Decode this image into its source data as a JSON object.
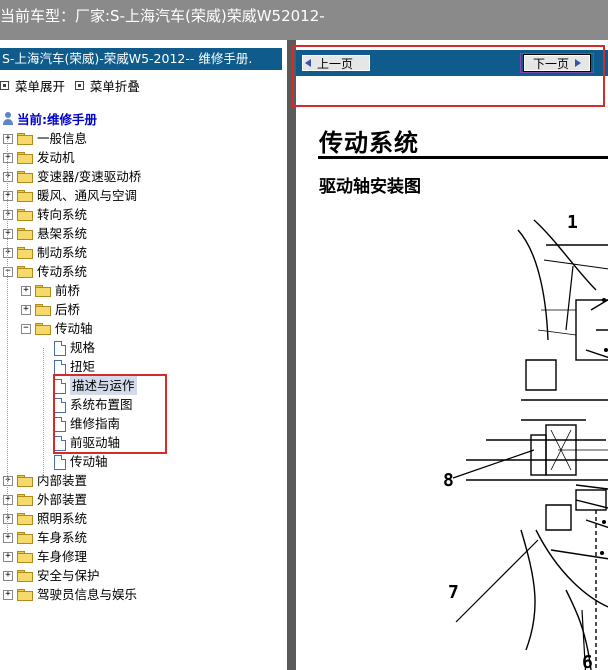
{
  "window": {
    "title": "当前车型：厂家:S-上海汽车(荣威)荣威W52012-"
  },
  "sidebar": {
    "manual_title": "S-上海汽车(荣威)-荣威W5-2012-- 维修手册.",
    "expand_label": "菜单展开",
    "collapse_label": "菜单折叠",
    "root_label": "当前:维修手册",
    "items": [
      {
        "label": "一般信息",
        "state": "collapsed"
      },
      {
        "label": "发动机",
        "state": "collapsed"
      },
      {
        "label": "变速器/变速驱动桥",
        "state": "collapsed"
      },
      {
        "label": "暖风、通风与空调",
        "state": "collapsed"
      },
      {
        "label": "转向系统",
        "state": "collapsed"
      },
      {
        "label": "悬架系统",
        "state": "collapsed"
      },
      {
        "label": "制动系统",
        "state": "collapsed"
      },
      {
        "label": "传动系统",
        "state": "expanded",
        "children": [
          {
            "label": "前桥",
            "state": "collapsed"
          },
          {
            "label": "后桥",
            "state": "collapsed"
          },
          {
            "label": "传动轴",
            "state": "expanded",
            "children": [
              {
                "label": "规格"
              },
              {
                "label": "扭矩"
              },
              {
                "label": "描述与运作",
                "selected": true
              },
              {
                "label": "系统布置图"
              },
              {
                "label": "维修指南"
              },
              {
                "label": "前驱动轴"
              },
              {
                "label": "传动轴"
              }
            ]
          }
        ]
      },
      {
        "label": "内部装置",
        "state": "collapsed"
      },
      {
        "label": "外部装置",
        "state": "collapsed"
      },
      {
        "label": "照明系统",
        "state": "collapsed"
      },
      {
        "label": "车身系统",
        "state": "collapsed"
      },
      {
        "label": "车身修理",
        "state": "collapsed"
      },
      {
        "label": "安全与保护",
        "state": "collapsed"
      },
      {
        "label": "驾驶员信息与娱乐",
        "state": "collapsed"
      }
    ]
  },
  "content": {
    "prev_label": "上一页",
    "next_label": "下一页",
    "page_title": "传动系统",
    "section_title": "驱动轴安装图",
    "callouts": [
      "1",
      "8",
      "7",
      "6"
    ]
  },
  "colors": {
    "titlebar": "#8a8a8a",
    "accent": "#0f5c8c",
    "highlight": "#d62b2b"
  }
}
